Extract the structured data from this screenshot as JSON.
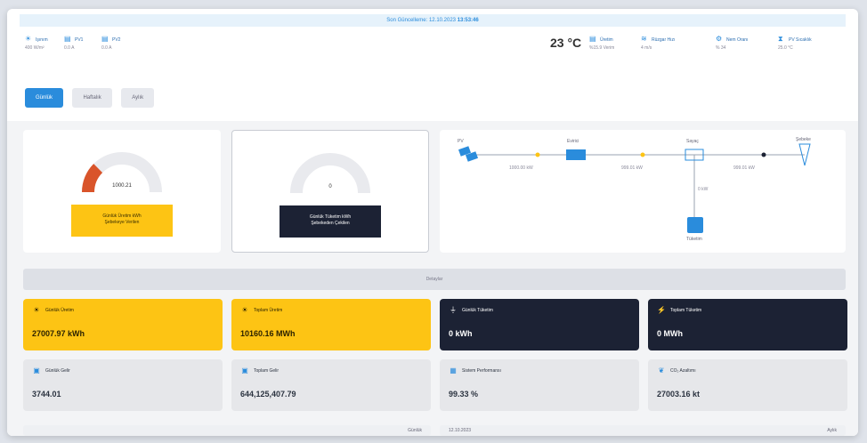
{
  "timebar": {
    "label": "Son Güncelleme: 12.10.2023",
    "time": "13:53:46"
  },
  "status": {
    "items": [
      {
        "icon": "sun-icon",
        "label": "Işınım",
        "sub": "400 W/m²"
      },
      {
        "icon": "panel-icon",
        "label": "PV1",
        "sub": "0.0 A"
      },
      {
        "icon": "panel-icon",
        "label": "PV2",
        "sub": "0.0 A"
      }
    ],
    "temperature": "23 °C",
    "right_items": [
      {
        "icon": "panel-icon",
        "label": "Üretim",
        "sub": "%15.9 Verim"
      },
      {
        "icon": "wind-icon",
        "label": "Rüzgar Hızı",
        "sub": "4 m/s"
      },
      {
        "icon": "gear-icon",
        "label": "Nem Oranı",
        "sub": "% 34"
      },
      {
        "icon": "thermometer-icon",
        "label": "PV Sıcaklık",
        "sub": "25.0 °C"
      }
    ]
  },
  "tabs": [
    {
      "label": "Günlük",
      "active": true
    },
    {
      "label": "Haftalık",
      "active": false
    },
    {
      "label": "Aylık",
      "active": false
    }
  ],
  "gauges": [
    {
      "value": "1000.21",
      "box": [
        "Günlük Üretim kWh",
        "Şebekeye Verilen"
      ],
      "fraction": 0.25,
      "color": "#d9542a"
    },
    {
      "value": "0",
      "box": [
        "Günlük Tüketim kWh",
        "Şebekeden Çekilen"
      ],
      "fraction": 0.0,
      "color": "#d9542a"
    }
  ],
  "flow": {
    "nodes": {
      "pv": "PV",
      "inverter": "Evirici",
      "meter": "Sayaç",
      "grid": "Şebeke",
      "load": "Tüketim"
    },
    "edges": {
      "e1": "1000.00 kW",
      "e2": "999.01 kW",
      "e3": "999.01 kW",
      "down": "0 kW"
    }
  },
  "divider": "Detaylar",
  "kpis": [
    {
      "icon": "sun-icon",
      "title": "Günlük Üretim",
      "value": "27007.97 kWh",
      "style": "yellow"
    },
    {
      "icon": "sun-icon",
      "title": "Toplam Üretim",
      "value": "10160.16 MWh",
      "style": "yellow"
    },
    {
      "icon": "plug-icon",
      "title": "Günlük Tüketim",
      "value": "0 kWh",
      "style": "dark"
    },
    {
      "icon": "tower-icon",
      "title": "Toplam Tüketim",
      "value": "0 MWh",
      "style": "dark"
    },
    {
      "icon": "wallet-icon",
      "title": "Günlük Gelir",
      "value": "3744.01",
      "style": "grey"
    },
    {
      "icon": "wallet-icon",
      "title": "Toplam Gelir",
      "value": "644,125,407.79",
      "style": "grey"
    },
    {
      "icon": "chart-icon",
      "title": "Sistem Performansı",
      "value": "99.33 %",
      "style": "grey"
    },
    {
      "icon": "leaf-icon",
      "title": "CO₂ Azaltımı",
      "value": "27003.16 kt",
      "style": "grey"
    }
  ],
  "bottom": {
    "left_label": "Günlük",
    "date": "12.10.2023",
    "right_label": "Aylık"
  }
}
